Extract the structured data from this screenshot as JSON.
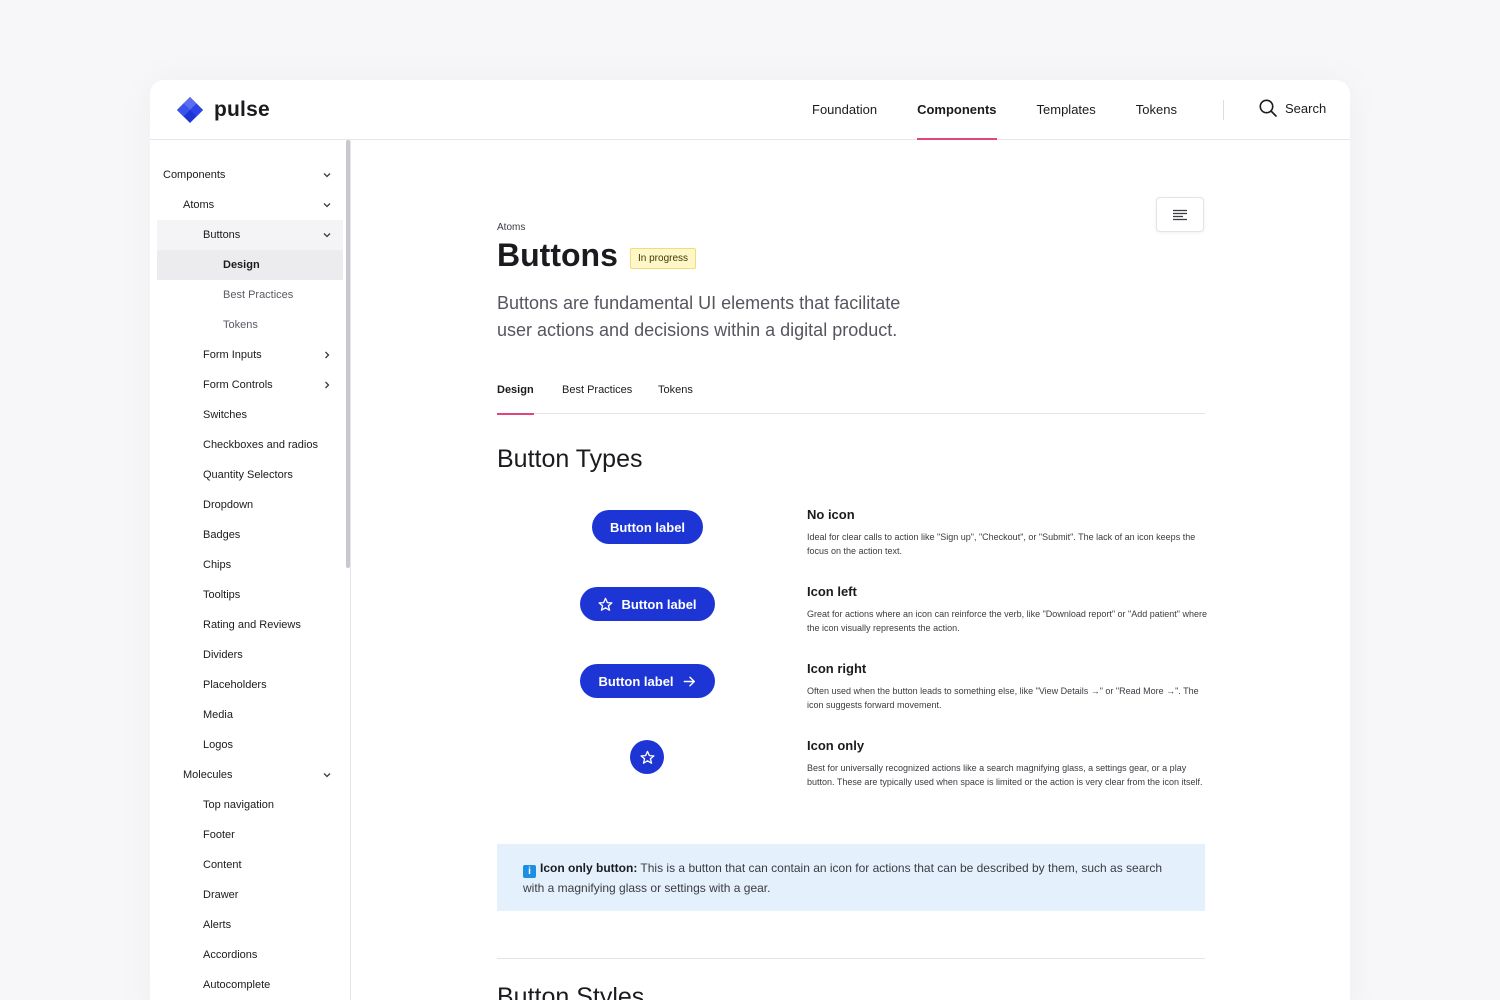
{
  "brand": {
    "name": "pulse",
    "accent": "#1e35d6",
    "highlight": "#e0457b"
  },
  "topnav": {
    "items": [
      {
        "label": "Foundation",
        "active": false
      },
      {
        "label": "Components",
        "active": true
      },
      {
        "label": "Templates",
        "active": false
      },
      {
        "label": "Tokens",
        "active": false
      }
    ],
    "search_label": "Search"
  },
  "sidebar": {
    "items": [
      {
        "label": "Components",
        "expanded": true
      },
      {
        "label": "Atoms",
        "expanded": true
      },
      {
        "label": "Buttons",
        "expanded": true
      },
      {
        "label": "Design",
        "selected": true
      },
      {
        "label": "Best Practices"
      },
      {
        "label": "Tokens"
      },
      {
        "label": "Form Inputs",
        "has_children": true
      },
      {
        "label": "Form Controls",
        "has_children": true
      },
      {
        "label": "Switches"
      },
      {
        "label": "Checkboxes and radios"
      },
      {
        "label": "Quantity Selectors"
      },
      {
        "label": "Dropdown"
      },
      {
        "label": "Badges"
      },
      {
        "label": "Chips"
      },
      {
        "label": "Tooltips"
      },
      {
        "label": "Rating and Reviews"
      },
      {
        "label": "Dividers"
      },
      {
        "label": "Placeholders"
      },
      {
        "label": "Media"
      },
      {
        "label": "Logos"
      },
      {
        "label": "Molecules",
        "expanded": true
      },
      {
        "label": "Top navigation"
      },
      {
        "label": "Footer"
      },
      {
        "label": "Content"
      },
      {
        "label": "Drawer"
      },
      {
        "label": "Alerts"
      },
      {
        "label": "Accordions"
      },
      {
        "label": "Autocomplete"
      }
    ]
  },
  "page": {
    "eyebrow": "Atoms",
    "title": "Buttons",
    "status": "In progress",
    "lead": "Buttons are fundamental UI elements that facilitate user actions and decisions within a digital product.",
    "tabs": [
      {
        "label": "Design",
        "active": true
      },
      {
        "label": "Best Practices",
        "active": false
      },
      {
        "label": "Tokens",
        "active": false
      }
    ],
    "section_title": "Button Types",
    "button_label": "Button label",
    "types": [
      {
        "title": "No icon",
        "desc": "Ideal for clear calls to action like \"Sign up\", \"Checkout\", or \"Submit\". The lack of an icon keeps the focus on the action text."
      },
      {
        "title": "Icon left",
        "desc": "Great for actions where an icon can reinforce the verb, like \"Download report\" or \"Add patient\" where the icon visually represents the action."
      },
      {
        "title": "Icon right",
        "desc": "Often used when the button leads to something else, like \"View Details →\" or \"Read More →\". The icon suggests forward movement."
      },
      {
        "title": "Icon only",
        "desc": "Best for universally recognized actions like a search magnifying glass, a settings gear, or a play button. These are typically used when space is limited or the action is very clear from the icon itself."
      }
    ],
    "info": {
      "icon_glyph": "i",
      "strong": "Icon only button:",
      "text": " This is a button that can contain an icon for actions that can be described by them, such as search with a magnifying glass or settings with a gear."
    },
    "next_section_title": "Button Styles"
  }
}
